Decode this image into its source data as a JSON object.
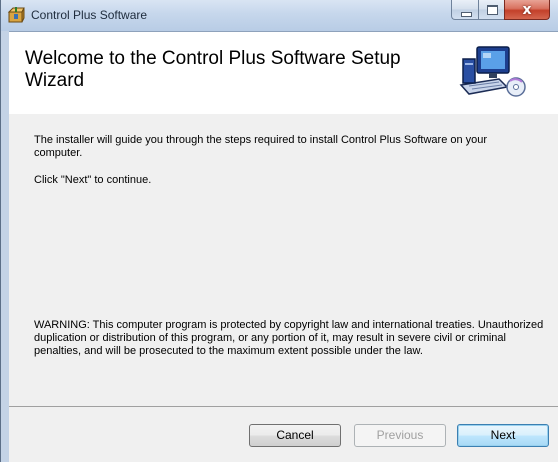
{
  "window": {
    "title": "Control Plus Software",
    "icon": "installer-box-icon"
  },
  "caption_buttons": {
    "minimize": "minimize-icon",
    "maximize": "maximize-icon",
    "close": "close-icon",
    "close_glyph": "x"
  },
  "banner": {
    "title": "Welcome to the Control Plus Software Setup Wizard",
    "icon": "computer-setup-icon"
  },
  "content": {
    "intro": "The installer will guide you through the steps required to install Control Plus Software on your computer.",
    "continue_hint": "Click \"Next\" to continue.",
    "warning": "WARNING: This computer program is protected by copyright law and international treaties. Unauthorized duplication or distribution of this program, or any portion of it, may result in severe civil or criminal penalties, and will be prosecuted to the maximum extent possible under the law."
  },
  "buttons": {
    "cancel": "Cancel",
    "previous": "Previous",
    "next": "Next"
  }
}
